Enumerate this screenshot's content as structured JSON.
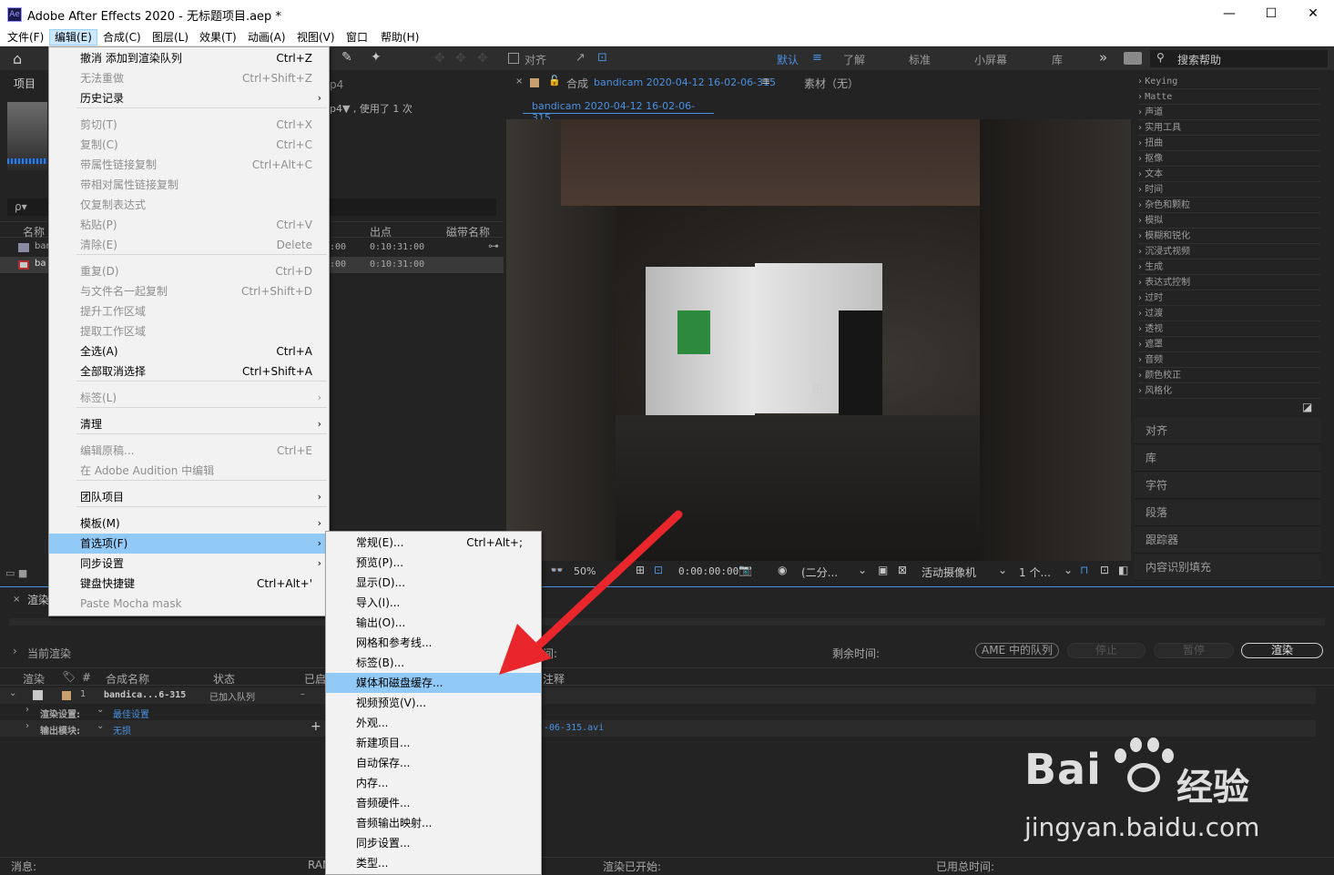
{
  "window": {
    "title": "Adobe After Effects 2020 - 无标题项目.aep *",
    "app_icon": "Ae",
    "minimize": "—",
    "maximize": "☐",
    "close": "✕"
  },
  "menubar": [
    "文件(F)",
    "编辑(E)",
    "合成(C)",
    "图层(L)",
    "效果(T)",
    "动画(A)",
    "视图(V)",
    "窗口",
    "帮助(H)"
  ],
  "toolbar": {
    "align_label": "对齐",
    "workspaces": [
      "默认",
      "了解",
      "标准",
      "小屏幕",
      "库"
    ],
    "more": "»",
    "search_placeholder": "搜索帮助"
  },
  "project": {
    "tab": "项目",
    "file_ext": "p4",
    "file_info": "p4▼ , 使用了 1 次",
    "search_icon": "ρ▾",
    "columns": [
      "名称",
      "出点",
      "磁带名称"
    ],
    "rows": [
      {
        "name": "ban",
        "in": ":00",
        "out": "0:10:31:00"
      },
      {
        "name": "ba",
        "in": ":00",
        "out": "0:10:31:00"
      }
    ]
  },
  "composition": {
    "tab_prefix": "合成",
    "tab_name": "bandicam 2020-04-12 16-02-06-315",
    "footage": "素材（无）",
    "breadcrumb": "bandicam 2020-04-12 16-02-06-315",
    "viewer": {
      "zoom": "50%",
      "timecode": "0:00:00:00",
      "resolution": "(二分...",
      "camera": "活动摄像机",
      "views": "1 个..."
    }
  },
  "effects": [
    "Keying",
    "Matte",
    "声道",
    "实用工具",
    "扭曲",
    "抠像",
    "文本",
    "时间",
    "杂色和颗粒",
    "模拟",
    "模糊和锐化",
    "沉浸式视频",
    "生成",
    "表达式控制",
    "过时",
    "过渡",
    "透视",
    "遮罩",
    "音频",
    "颜色校正",
    "风格化"
  ],
  "side_panels": [
    "对齐",
    "库",
    "字符",
    "段落",
    "跟踪器",
    "内容识别填充"
  ],
  "render": {
    "tab": "渲染",
    "current_render": "当前渲染",
    "time_label": "间:",
    "remaining": "剩余时间:",
    "btn_ame": "AME 中的队列",
    "btn_stop": "停止",
    "btn_pause": "暂停",
    "btn_render": "渲染",
    "columns": [
      "渲染",
      "#",
      "合成名称",
      "状态",
      "已启",
      "注释"
    ],
    "item": {
      "num": "1",
      "name": "bandica...6-315",
      "status": "已加入队列",
      "dash": "–"
    },
    "render_settings_label": "渲染设置:",
    "render_settings_value": "最佳设置",
    "output_module_label": "输出模块:",
    "output_module_value": "无损",
    "output_file": "-06-315.avi",
    "footer": {
      "message": "消息:",
      "ram": "RAM",
      "render_started": "渲染已开始:",
      "total_time": "已用总时间:"
    }
  },
  "edit_menu": [
    {
      "label": "撤消 添加到渲染队列",
      "shortcut": "Ctrl+Z",
      "disabled": false
    },
    {
      "label": "无法重做",
      "shortcut": "Ctrl+Shift+Z",
      "disabled": true
    },
    {
      "label": "历史记录",
      "shortcut": "",
      "arrow": true,
      "disabled": false
    },
    {
      "label": "剪切(T)",
      "shortcut": "Ctrl+X",
      "disabled": true
    },
    {
      "label": "复制(C)",
      "shortcut": "Ctrl+C",
      "disabled": true
    },
    {
      "label": "带属性链接复制",
      "shortcut": "Ctrl+Alt+C",
      "disabled": true
    },
    {
      "label": "带相对属性链接复制",
      "shortcut": "",
      "disabled": true
    },
    {
      "label": "仅复制表达式",
      "shortcut": "",
      "disabled": true
    },
    {
      "label": "粘贴(P)",
      "shortcut": "Ctrl+V",
      "disabled": true
    },
    {
      "label": "清除(E)",
      "shortcut": "Delete",
      "disabled": true
    },
    {
      "label": "重复(D)",
      "shortcut": "Ctrl+D",
      "disabled": true
    },
    {
      "label": "与文件名一起复制",
      "shortcut": "Ctrl+Shift+D",
      "disabled": true
    },
    {
      "label": "提升工作区域",
      "shortcut": "",
      "disabled": true
    },
    {
      "label": "提取工作区域",
      "shortcut": "",
      "disabled": true
    },
    {
      "label": "全选(A)",
      "shortcut": "Ctrl+A",
      "disabled": false
    },
    {
      "label": "全部取消选择",
      "shortcut": "Ctrl+Shift+A",
      "disabled": false
    },
    {
      "label": "标签(L)",
      "shortcut": "",
      "arrow": true,
      "disabled": true
    },
    {
      "label": "清理",
      "shortcut": "",
      "arrow": true,
      "disabled": false
    },
    {
      "label": "编辑原稿...",
      "shortcut": "Ctrl+E",
      "disabled": true
    },
    {
      "label": "在 Adobe Audition 中编辑",
      "shortcut": "",
      "disabled": true
    },
    {
      "label": "团队项目",
      "shortcut": "",
      "arrow": true,
      "disabled": false
    },
    {
      "label": "模板(M)",
      "shortcut": "",
      "arrow": true,
      "disabled": false
    },
    {
      "label": "首选项(F)",
      "shortcut": "",
      "arrow": true,
      "disabled": false,
      "highlighted": true
    },
    {
      "label": "同步设置",
      "shortcut": "",
      "arrow": true,
      "disabled": false
    },
    {
      "label": "键盘快捷键",
      "shortcut": "Ctrl+Alt+'",
      "disabled": false
    },
    {
      "label": "Paste Mocha mask",
      "shortcut": "",
      "disabled": true
    }
  ],
  "prefs_menu": [
    {
      "label": "常规(E)...",
      "shortcut": "Ctrl+Alt+;"
    },
    {
      "label": "预览(P)...",
      "shortcut": ""
    },
    {
      "label": "显示(D)...",
      "shortcut": ""
    },
    {
      "label": "导入(I)...",
      "shortcut": ""
    },
    {
      "label": "输出(O)...",
      "shortcut": ""
    },
    {
      "label": "网格和参考线...",
      "shortcut": ""
    },
    {
      "label": "标签(B)...",
      "shortcut": ""
    },
    {
      "label": "媒体和磁盘缓存...",
      "shortcut": "",
      "highlighted": true
    },
    {
      "label": "视频预览(V)...",
      "shortcut": ""
    },
    {
      "label": "外观...",
      "shortcut": ""
    },
    {
      "label": "新建项目...",
      "shortcut": ""
    },
    {
      "label": "自动保存...",
      "shortcut": ""
    },
    {
      "label": "内存...",
      "shortcut": ""
    },
    {
      "label": "音频硬件...",
      "shortcut": ""
    },
    {
      "label": "音频输出映射...",
      "shortcut": ""
    },
    {
      "label": "同步设置...",
      "shortcut": ""
    },
    {
      "label": "类型...",
      "shortcut": ""
    }
  ],
  "watermark": {
    "brand": "Bai",
    "brand2": "经验",
    "url": "jingyan.baidu.com"
  },
  "colors": {
    "accent": "#4a90e2",
    "menu_highlight": "#91c9f7",
    "arrow": "#e8262b"
  }
}
